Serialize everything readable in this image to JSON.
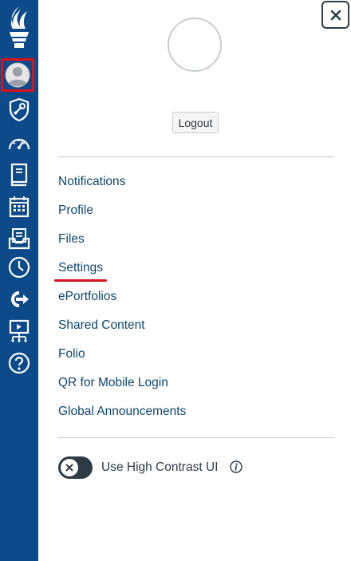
{
  "profile_tray": {
    "logout_label": "Logout",
    "menu_items": [
      "Notifications",
      "Profile",
      "Files",
      "Settings",
      "ePortfolios",
      "Shared Content",
      "Folio",
      "QR for Mobile Login",
      "Global Announcements"
    ],
    "high_contrast_label": "Use High Contrast UI",
    "high_contrast_enabled": false
  },
  "global_nav": {
    "icons": [
      "logo-icon",
      "account-avatar-icon",
      "admin-icon",
      "dashboard-icon",
      "courses-icon",
      "calendar-icon",
      "inbox-icon",
      "history-icon",
      "commons-icon",
      "studio-icon",
      "help-icon"
    ]
  },
  "colors": {
    "nav_background": "#0d4a8a",
    "link": "#0e466e",
    "highlight": "#e0101a"
  }
}
